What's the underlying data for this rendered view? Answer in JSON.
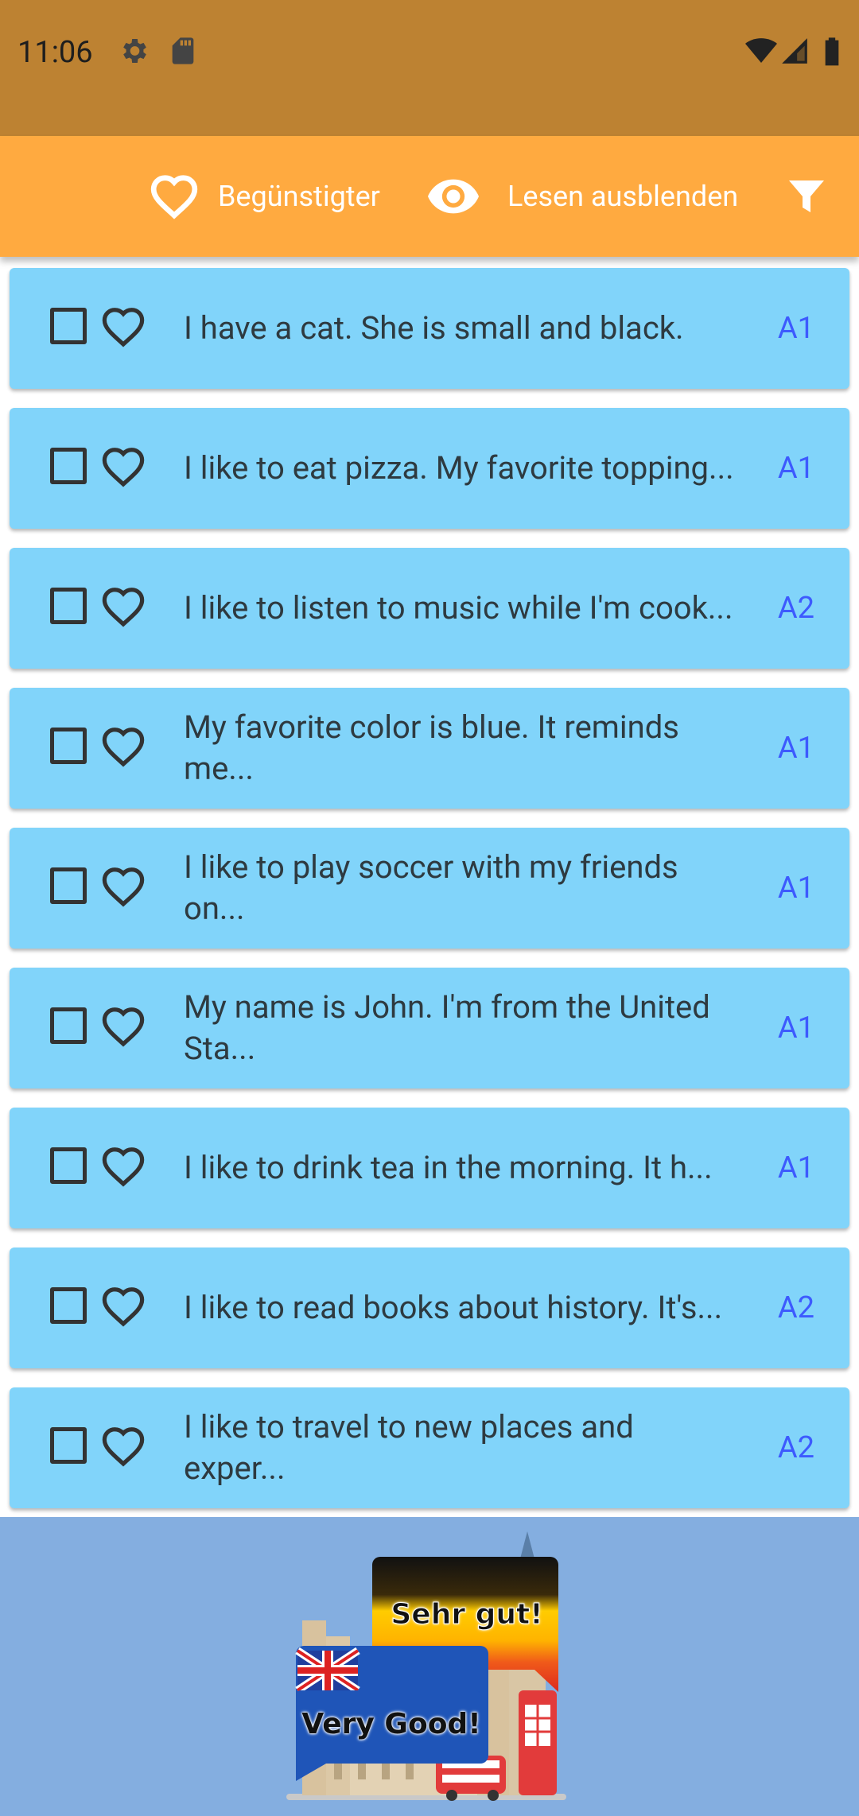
{
  "status_bar": {
    "time": "11:06"
  },
  "toolbar": {
    "favorites_label": "Begünstigter",
    "hide_read_label": "Lesen ausblenden"
  },
  "stories": [
    {
      "text": "I have a cat. She is small and black.",
      "level": "A1"
    },
    {
      "text": "I like to eat pizza. My favorite topping...",
      "level": "A1"
    },
    {
      "text": "I like to listen to music while I'm cook...",
      "level": "A2"
    },
    {
      "text": "My favorite color is blue. It reminds me...",
      "level": "A1"
    },
    {
      "text": "I like to play soccer with my friends on...",
      "level": "A1"
    },
    {
      "text": "My name is John. I'm from the United Sta...",
      "level": "A1"
    },
    {
      "text": "I like to drink tea in the morning. It h...",
      "level": "A1"
    },
    {
      "text": "I like to read books about history. It's...",
      "level": "A2"
    },
    {
      "text": "I like to travel to new places and exper...",
      "level": "A2"
    }
  ],
  "banner": {
    "german_bubble": "Sehr gut!",
    "english_bubble": "Very Good!"
  },
  "colors": {
    "status_bar": "#bd8232",
    "toolbar": "#ffaa40",
    "card": "#81d4fa",
    "level_text": "#3d5afe",
    "banner_bg": "#84aee0"
  }
}
